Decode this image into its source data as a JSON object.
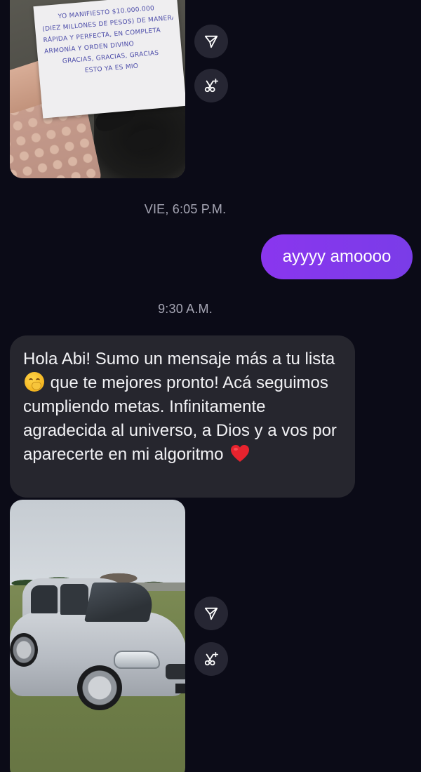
{
  "conversation": {
    "photo_note": {
      "handwritten_lines": [
        "Yo manifiesto $10.000.000",
        "(Diez millones de pesos) de manera",
        "rápida y perfecta, en completa",
        "armonía y orden divino",
        "Gracias, gracias, gracias",
        "esto ya es mio"
      ]
    },
    "timestamp_1": "VIE, 6:05 P.M.",
    "outgoing_message": "ayyyy amoooo",
    "timestamp_2": "9:30 A.M.",
    "incoming_message": {
      "part_1": "Hola Abi! Sumo un mensaje más a tu lista",
      "emoji_1": "face-with-hand-over-mouth",
      "part_2": " que te mejores pronto! Acá seguimos cumpliendo metas. Infinitamente agradecida al universo, a Dios y a vos por aparecerte en mi algoritmo",
      "emoji_2": "red-heart"
    },
    "actions": {
      "share_icon": "paper-plane-icon",
      "remix_icon": "scissors-sparkle-icon"
    }
  },
  "colors": {
    "background": "#0b0b17",
    "outgoing_bubble": "#8a36ee",
    "incoming_bubble": "#26262e",
    "timestamp_text": "#a6a6b4",
    "action_button": "#262633"
  }
}
